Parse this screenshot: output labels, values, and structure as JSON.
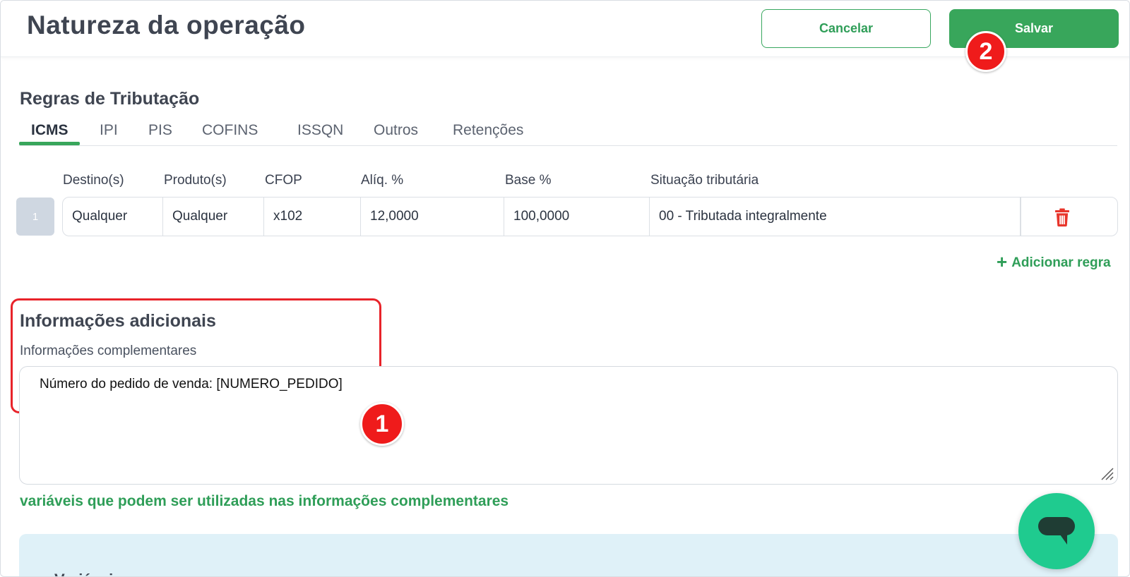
{
  "header": {
    "title": "Natureza da operação",
    "cancel_label": "Cancelar",
    "save_label": "Salvar"
  },
  "markers": {
    "one": "1",
    "two": "2"
  },
  "taxation": {
    "title": "Regras de Tributação",
    "tabs": [
      {
        "label": "ICMS",
        "active": true
      },
      {
        "label": "IPI"
      },
      {
        "label": "PIS"
      },
      {
        "label": "COFINS"
      },
      {
        "label": "ISSQN"
      },
      {
        "label": "Outros"
      },
      {
        "label": "Retenções"
      }
    ],
    "columns": [
      "Destino(s)",
      "Produto(s)",
      "CFOP",
      "Alíq. %",
      "Base %",
      "Situação tributária"
    ],
    "rows": [
      {
        "index": "1",
        "destino": "Qualquer",
        "produto": "Qualquer",
        "cfop": "x102",
        "aliq": "12,0000",
        "base": "100,0000",
        "situacao": "00 - Tributada integralmente"
      }
    ],
    "add_rule_label": "Adicionar regra"
  },
  "additional_info": {
    "title": "Informações adicionais",
    "field_label": "Informações complementares",
    "field_value": "Número do pedido de venda: [NUMERO_PEDIDO]",
    "variables_link": "variáveis que podem ser utilizadas nas informações complementares",
    "variables_panel_title": "Variáveis"
  },
  "colors": {
    "brand_green": "#38a65b",
    "marker_red": "#ef1b1b",
    "chat_green": "#1fcb8f",
    "panel_blue": "#dff1f8"
  },
  "icons": [
    "trash-icon",
    "plus-icon",
    "resize-grip-icon",
    "chat-icon"
  ]
}
